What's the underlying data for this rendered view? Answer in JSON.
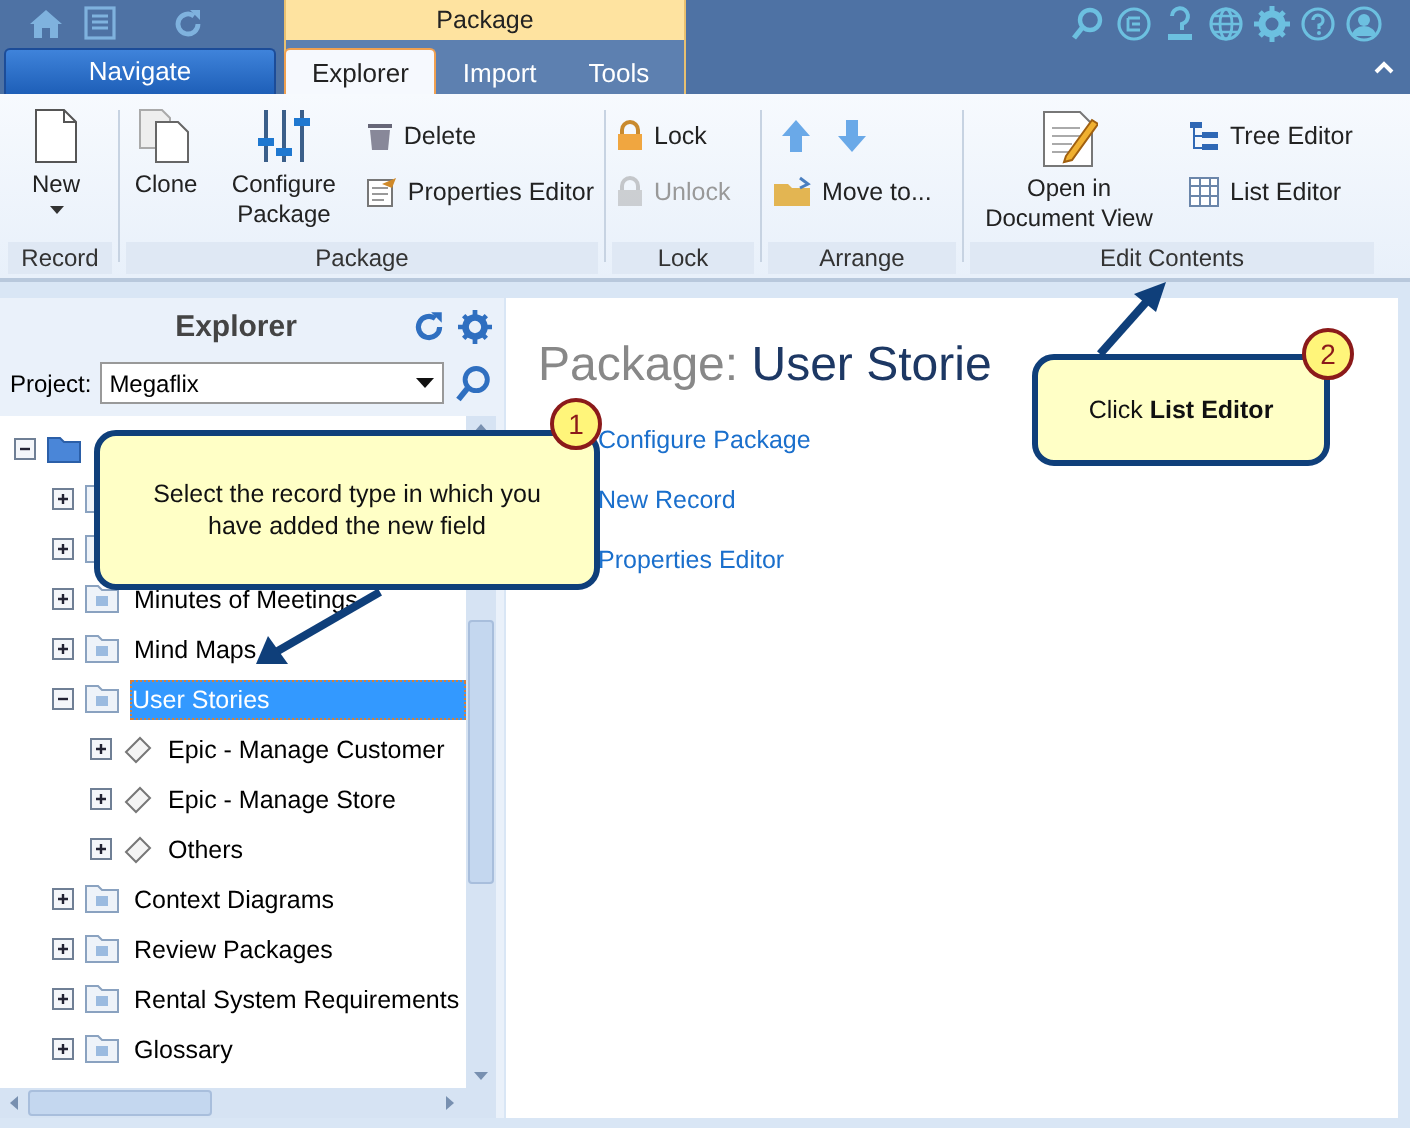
{
  "context_tab": {
    "label": "Package"
  },
  "tabs": [
    {
      "label": "Navigate",
      "kind": "app",
      "selected": false
    },
    {
      "label": "Explorer",
      "kind": "tab",
      "selected": true
    },
    {
      "label": "Import",
      "kind": "tab",
      "selected": false
    },
    {
      "label": "Tools",
      "kind": "tab",
      "selected": false
    }
  ],
  "ribbon_groups": [
    {
      "label": "Record",
      "commands": [
        {
          "label": "New",
          "kind": "large",
          "dropdown": true,
          "disabled": false
        }
      ]
    },
    {
      "label": "Package",
      "commands": [
        {
          "label": "Clone",
          "kind": "large",
          "disabled": false
        },
        {
          "label": "Configure Package",
          "kind": "large",
          "disabled": false
        },
        {
          "label": "Delete",
          "kind": "small",
          "disabled": false
        },
        {
          "label": "Properties Editor",
          "kind": "small",
          "disabled": false
        }
      ]
    },
    {
      "label": "Lock",
      "commands": [
        {
          "label": "Lock",
          "kind": "small",
          "disabled": false
        },
        {
          "label": "Unlock",
          "kind": "small",
          "disabled": true
        }
      ]
    },
    {
      "label": "Arrange",
      "commands": [
        {
          "kind": "icon",
          "disabled": false
        },
        {
          "kind": "icon",
          "disabled": false
        },
        {
          "label": "Move to...",
          "kind": "small",
          "disabled": false
        }
      ]
    },
    {
      "label": "Edit Contents",
      "commands": [
        {
          "label": "Open in Document View",
          "kind": "large",
          "disabled": false
        },
        {
          "label": "Tree Editor",
          "kind": "small",
          "disabled": false
        },
        {
          "label": "List Editor",
          "kind": "small",
          "disabled": false
        }
      ]
    }
  ],
  "explorer": {
    "title": "Explorer",
    "project_label": "Project:",
    "project_value": "Megaflix",
    "tree": [
      {
        "expanded": true,
        "children": [
          {
            "expanded": false
          },
          {
            "expanded": false
          },
          {
            "label": "Minutes of Meetings",
            "expanded": false,
            "selected": false
          },
          {
            "label": "Mind Maps",
            "expanded": false,
            "selected": false
          },
          {
            "label": "User Stories",
            "expanded": true,
            "selected": true,
            "children": [
              {
                "label": "Epic - Manage Customer",
                "expanded": false,
                "selected": false
              },
              {
                "label": "Epic - Manage Store",
                "expanded": false,
                "selected": false
              },
              {
                "label": "Others",
                "expanded": false,
                "selected": false
              }
            ]
          },
          {
            "label": "Context Diagrams",
            "expanded": false,
            "selected": false
          },
          {
            "label": "Review Packages",
            "expanded": false,
            "selected": false
          },
          {
            "label": "Rental System Requirements",
            "expanded": false,
            "selected": false
          },
          {
            "label": "Glossary",
            "expanded": false,
            "selected": false
          }
        ]
      }
    ]
  },
  "content": {
    "title_prefix": "Package:",
    "title_name": "User Storie",
    "links": [
      "Configure Package",
      "New Record",
      "Properties Editor"
    ]
  },
  "callouts": [
    {
      "number": "1",
      "text": "Select the record type in which you have added the new field"
    },
    {
      "number": "2",
      "text": "Click **List Editor**"
    }
  ]
}
